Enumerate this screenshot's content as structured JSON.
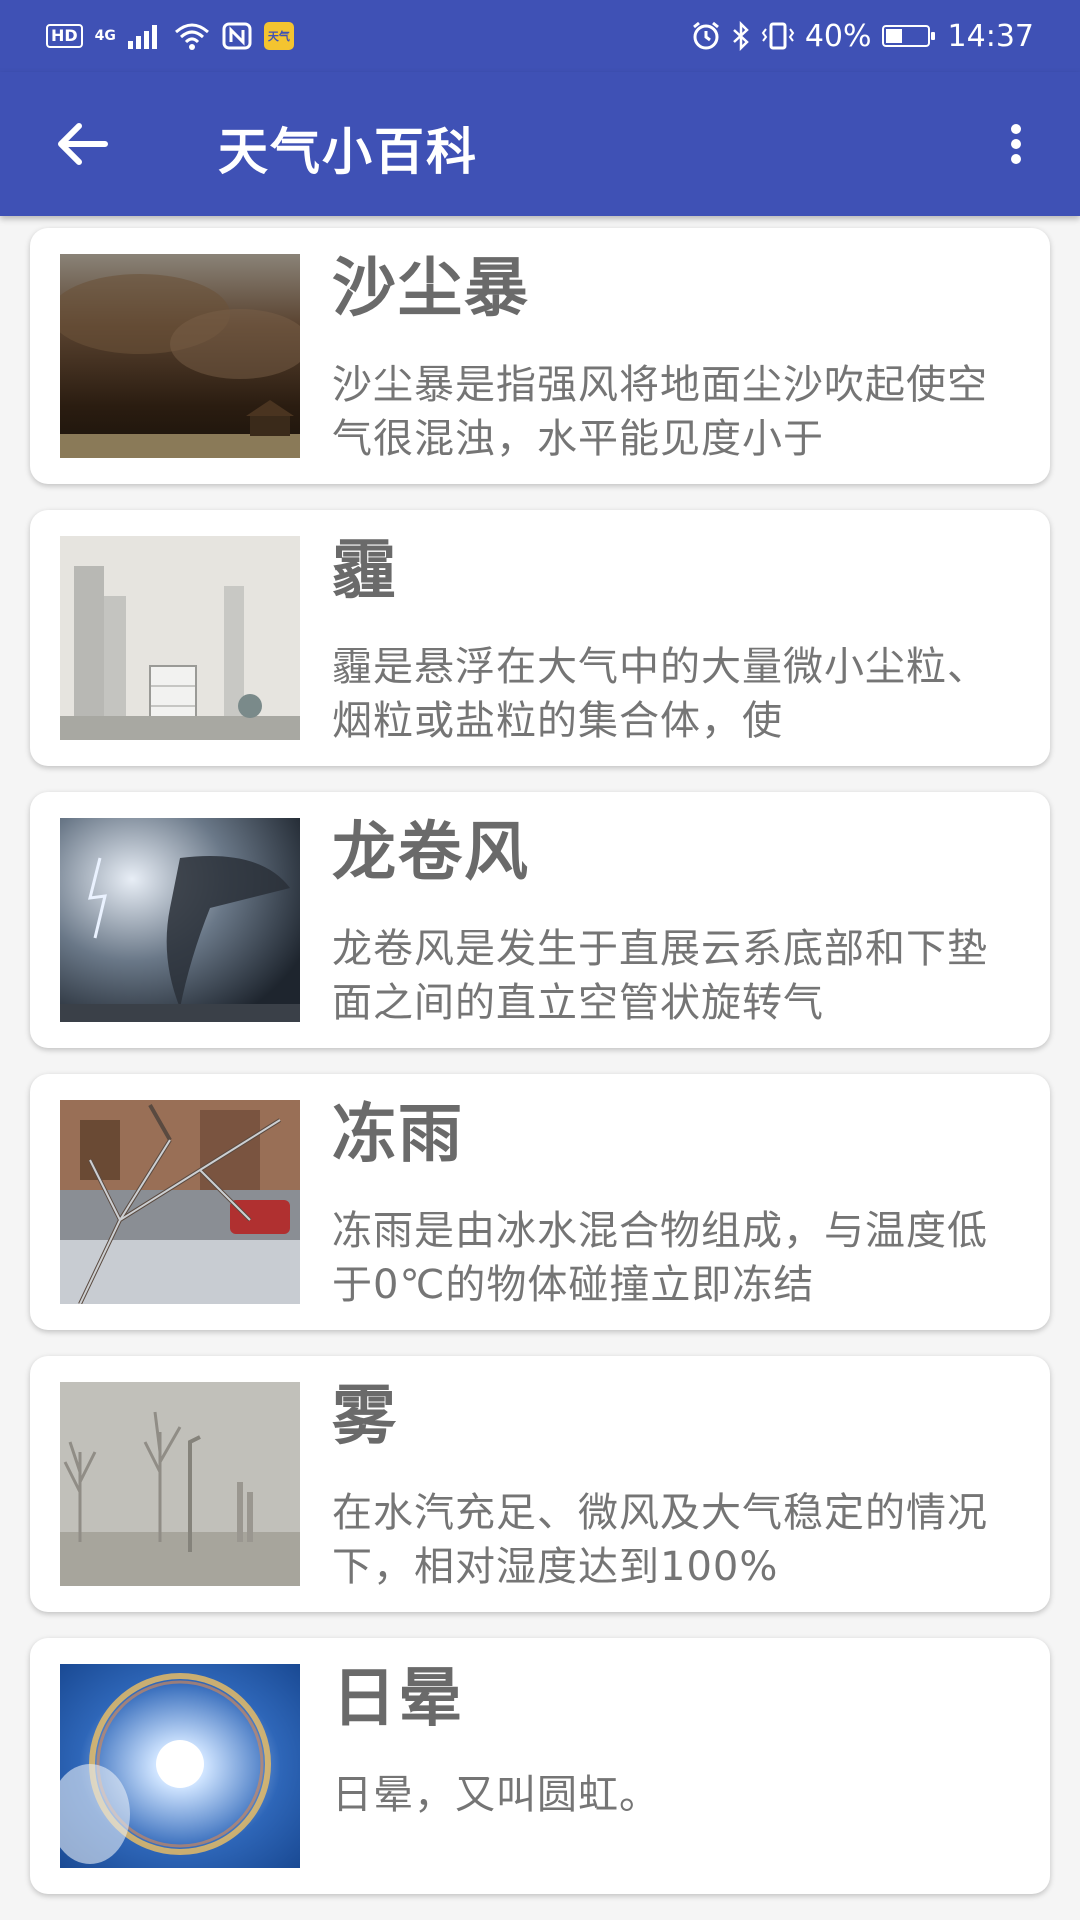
{
  "status_bar": {
    "hd": "HD",
    "network": "4G",
    "app_badge": "天气",
    "battery_percent": "40%",
    "battery_level": 0.4,
    "time": "14:37"
  },
  "app_bar": {
    "title": "天气小百科"
  },
  "items": [
    {
      "title": "沙尘暴",
      "description": "沙尘暴是指强风将地面尘沙吹起使空气很混浊，水平能见度小于",
      "image": "sandstorm"
    },
    {
      "title": "霾",
      "description": "霾是悬浮在大气中的大量微小尘粒、烟粒或盐粒的集合体，使",
      "image": "haze"
    },
    {
      "title": "龙卷风",
      "description": "龙卷风是发生于直展云系底部和下垫面之间的直立空管状旋转气",
      "image": "tornado"
    },
    {
      "title": "冻雨",
      "description": "冻雨是由冰水混合物组成，与温度低于0℃的物体碰撞立即冻结",
      "image": "freezing-rain"
    },
    {
      "title": "雾",
      "description": "在水汽充足、微风及大气稳定的情况下，相对湿度达到100%",
      "image": "fog"
    },
    {
      "title": "日晕",
      "description": "日晕，又叫圆虹。",
      "image": "halo"
    }
  ],
  "colors": {
    "primary": "#3f51b5",
    "title_text": "#6a6a6a",
    "body_text": "#757575"
  }
}
